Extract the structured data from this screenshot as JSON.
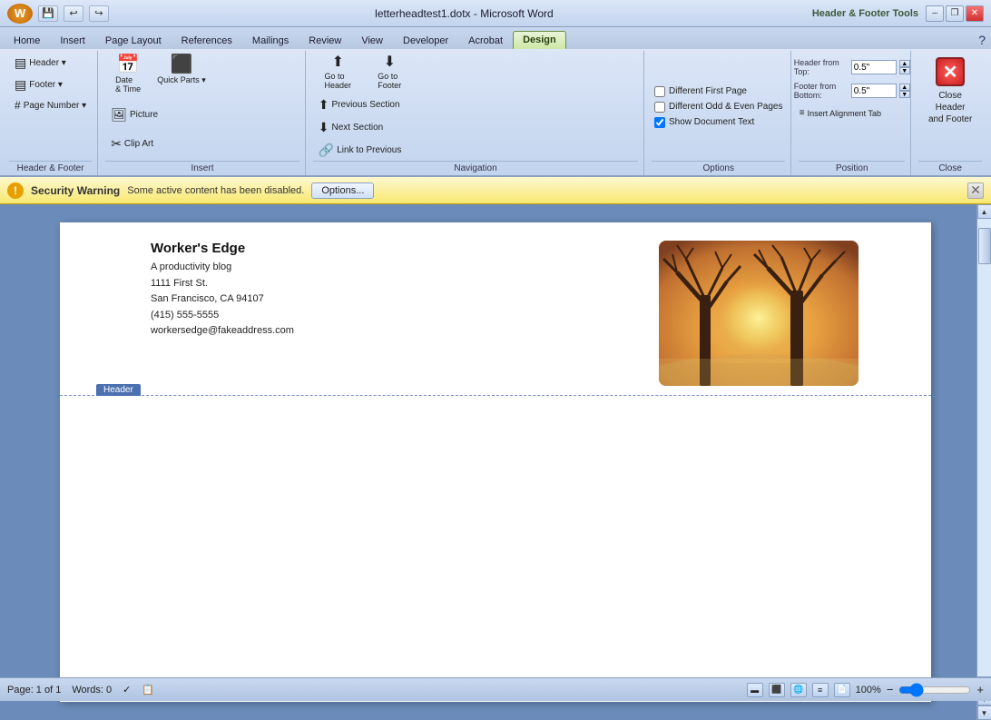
{
  "window": {
    "title": "letterheadtest1.dotx - Microsoft Word",
    "ribbon_section": "Header & Footer Tools"
  },
  "title_controls": {
    "minimize": "–",
    "restore": "❐",
    "close": "✕"
  },
  "tabs": [
    {
      "label": "Home",
      "key": "H"
    },
    {
      "label": "Insert",
      "key": "N"
    },
    {
      "label": "Page Layout",
      "key": "P"
    },
    {
      "label": "References",
      "key": "S"
    },
    {
      "label": "Mailings",
      "key": "M"
    },
    {
      "label": "Review",
      "key": "R"
    },
    {
      "label": "View",
      "key": "W"
    },
    {
      "label": "Developer",
      "key": "L"
    },
    {
      "label": "Acrobat",
      "key": "B"
    },
    {
      "label": "Design",
      "key": "JH",
      "active": true,
      "design": true
    }
  ],
  "ribbon_groups": {
    "header_footer": {
      "label": "Header & Footer",
      "items": [
        {
          "label": "Header",
          "icon": "▤",
          "has_arrow": true
        },
        {
          "label": "Footer",
          "icon": "▤",
          "has_arrow": true
        },
        {
          "label": "Page Number",
          "icon": "#",
          "has_arrow": true
        }
      ]
    },
    "insert": {
      "label": "Insert",
      "items": [
        {
          "label": "Date & Time",
          "icon": "📅"
        },
        {
          "label": "Quick Parts",
          "icon": "⬛",
          "has_arrow": true
        },
        {
          "label": "Picture",
          "icon": "🖼"
        },
        {
          "label": "Clip Art",
          "icon": "✂"
        }
      ]
    },
    "navigation": {
      "label": "Navigation",
      "items": [
        {
          "label": "Go to Header",
          "icon": "⬆"
        },
        {
          "label": "Go to Footer",
          "icon": "⬇"
        },
        {
          "label": "Previous Section",
          "icon": "⬆"
        },
        {
          "label": "Next Section",
          "icon": "⬇"
        },
        {
          "label": "Link to Previous",
          "icon": "🔗"
        }
      ]
    },
    "options": {
      "label": "Options",
      "items": [
        {
          "label": "Different First Page",
          "checked": false
        },
        {
          "label": "Different Odd & Even Pages",
          "checked": false
        },
        {
          "label": "Show Document Text",
          "checked": true
        }
      ]
    },
    "position": {
      "label": "Position",
      "header_from_top_label": "Header from Top:",
      "header_from_top_value": "0.5\"",
      "footer_from_bottom_label": "Footer from Bottom:",
      "footer_from_bottom_value": "0.5\""
    },
    "close": {
      "label": "Close",
      "button_label": "Close Header\nand Footer",
      "button_line1": "Close Header",
      "button_line2": "and Footer"
    }
  },
  "security_warning": {
    "title": "Security Warning",
    "message": "Some active content has been disabled.",
    "button_label": "Options..."
  },
  "document": {
    "header_label": "Header",
    "company_name": "Worker's Edge",
    "company_tagline": "A productivity blog",
    "address": "1111 First St.",
    "city_state": "San Francisco, CA 94107",
    "phone": "(415) 555-5555",
    "email": "workersedge@fakeaddress.com"
  },
  "status_bar": {
    "page": "Page: 1 of 1",
    "words": "Words: 0",
    "zoom": "100%"
  }
}
